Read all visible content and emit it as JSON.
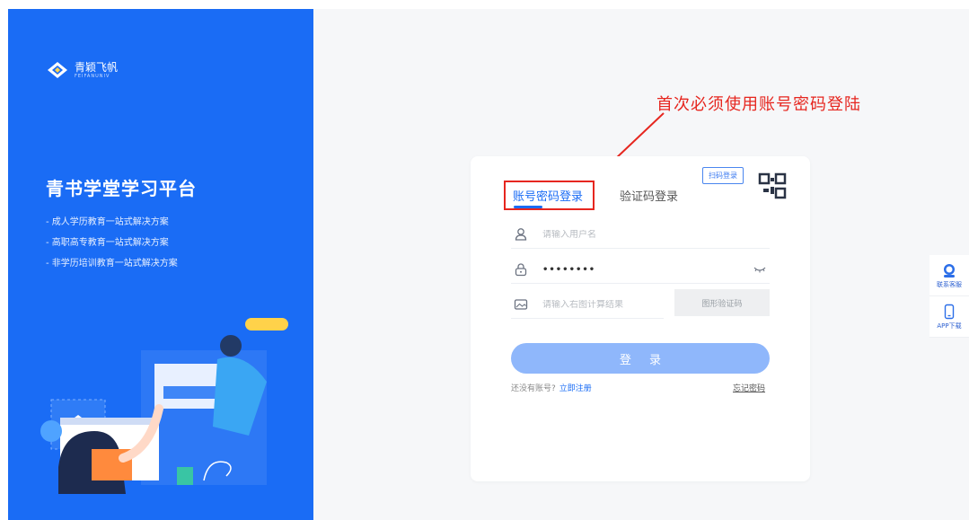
{
  "brand": {
    "name_cn": "青颖飞帆",
    "name_en": "FEIFANUNIV",
    "color": "#1a6cf5"
  },
  "hero": {
    "title": "青书学堂学习平台",
    "features": [
      "- 成人学历教育一站式解决方案",
      "- 高职高专教育一站式解决方案",
      "- 非学历培训教育一站式解决方案"
    ]
  },
  "annotation": {
    "text": "首次必须使用账号密码登陆",
    "color": "#e6261f"
  },
  "login": {
    "qr_tag": "扫码登录",
    "tabs": [
      {
        "label": "账号密码登录",
        "active": true
      },
      {
        "label": "验证码登录",
        "active": false
      }
    ],
    "username_placeholder": "请输入用户名",
    "password_value": "••••••••",
    "captcha_placeholder": "请输入右图计算结果",
    "captcha_image_text": "图形验证码",
    "submit_label": "登 录",
    "register_prompt": "还没有账号?",
    "register_link": "立即注册",
    "forgot_link": "忘记密码"
  },
  "float_tools": {
    "service_label": "联系客服",
    "app_label": "APP下载"
  },
  "icons": [
    "logo-icon",
    "user-icon",
    "lock-icon",
    "eye-icon",
    "image-icon",
    "qr-code-icon",
    "customer-service-icon",
    "phone-icon"
  ]
}
